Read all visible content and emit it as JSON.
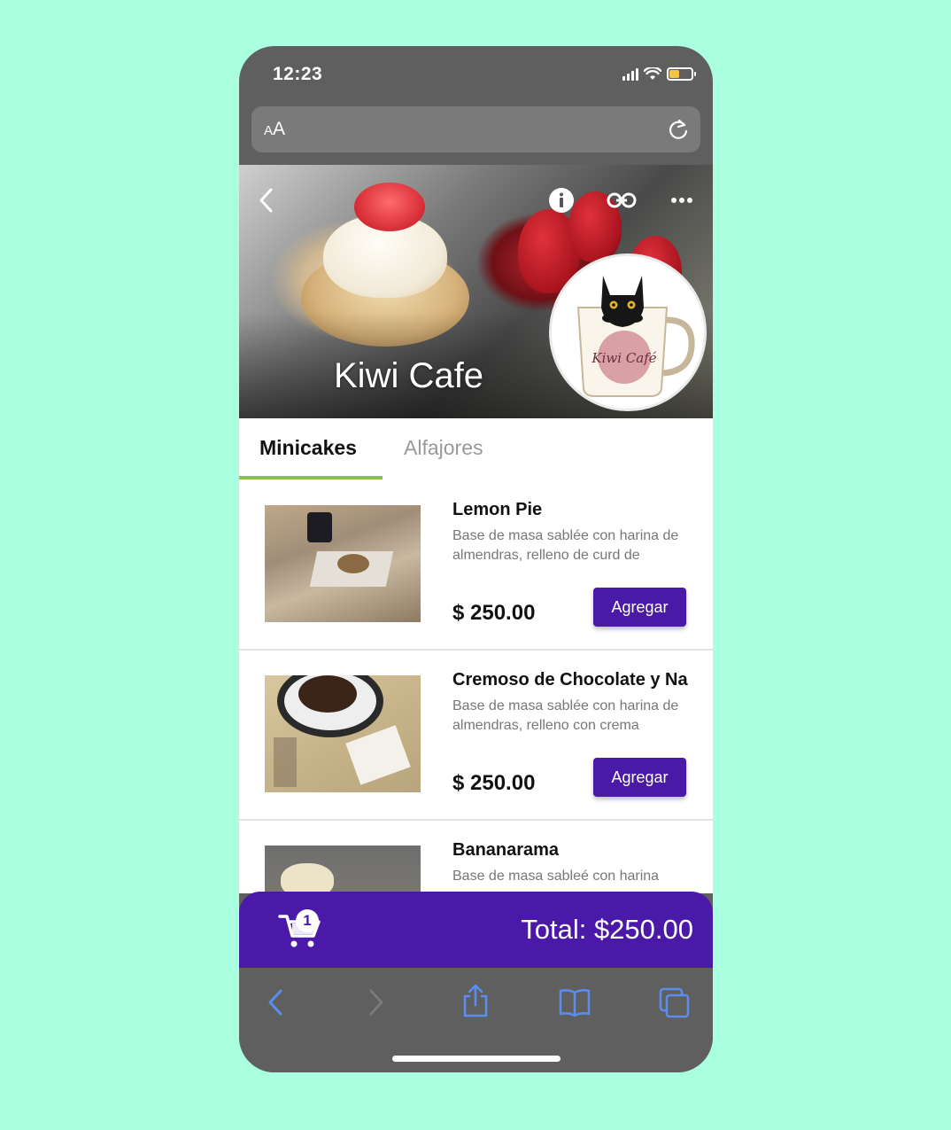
{
  "status_bar": {
    "time": "12:23"
  },
  "url_bar": {
    "text_small": "A",
    "text_large": "A"
  },
  "hero": {
    "title": "Kiwi Cafe",
    "logo_text": "Kiwi Café"
  },
  "tabs": [
    {
      "label": "Minicakes",
      "active": true
    },
    {
      "label": "Alfajores",
      "active": false
    }
  ],
  "products": [
    {
      "name": "Lemon Pie",
      "description": "Base de masa sablée con harina de almendras, relleno de curd de",
      "price": "$ 250.00",
      "button": "Agregar"
    },
    {
      "name": "Cremoso de Chocolate y Na",
      "description": "Base de masa sablée con harina de almendras, relleno con crema",
      "price": "$ 250.00",
      "button": "Agregar"
    },
    {
      "name": "Bananarama",
      "description": "Base de masa sableé con harina",
      "price": "",
      "button": ""
    }
  ],
  "cart": {
    "count": "1",
    "total": "Total: $250.00"
  },
  "colors": {
    "background": "#aaffe0",
    "accent": "#4a19a8",
    "tab_underline": "#8bc34a",
    "toolbar_icons": "#5b8def"
  }
}
